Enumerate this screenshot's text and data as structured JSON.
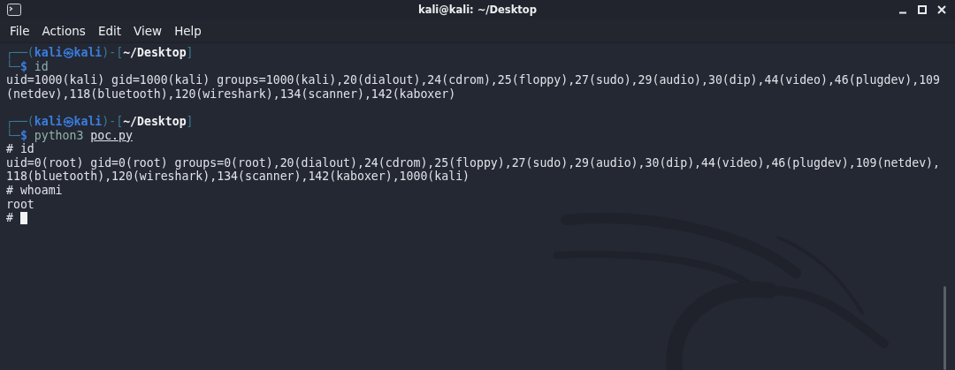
{
  "window": {
    "title": "kali@kali: ~/Desktop"
  },
  "menu": [
    "File",
    "Actions",
    "Edit",
    "View",
    "Help"
  ],
  "terminal": {
    "lines": [
      {
        "kind": "prompt",
        "open": "┌──(",
        "user": "kali㉿kali",
        "sep": ")-[",
        "cwd": "~/Desktop",
        "close": "]"
      },
      {
        "kind": "command",
        "corner": "└─",
        "dollar": "$",
        "command": "id"
      },
      {
        "kind": "output",
        "text": "uid=1000(kali) gid=1000(kali) groups=1000(kali),20(dialout),24(cdrom),25(floppy),27(sudo),29(audio),30(dip),44(video),46(plugdev),109"
      },
      {
        "kind": "output",
        "text": "(netdev),118(bluetooth),120(wireshark),134(scanner),142(kaboxer)"
      },
      {
        "kind": "blank"
      },
      {
        "kind": "prompt",
        "open": "┌──(",
        "user": "kali㉿kali",
        "sep": ")-[",
        "cwd": "~/Desktop",
        "close": "]"
      },
      {
        "kind": "command",
        "corner": "└─",
        "dollar": "$",
        "command": "python3",
        "argument": "poc.py"
      },
      {
        "kind": "output",
        "text": "# id"
      },
      {
        "kind": "output",
        "text": "uid=0(root) gid=0(root) groups=0(root),20(dialout),24(cdrom),25(floppy),27(sudo),29(audio),30(dip),44(video),46(plugdev),109(netdev),"
      },
      {
        "kind": "output",
        "text": "118(bluetooth),120(wireshark),134(scanner),142(kaboxer),1000(kali)"
      },
      {
        "kind": "output",
        "text": "# whoami"
      },
      {
        "kind": "output",
        "text": "root"
      },
      {
        "kind": "output",
        "text": "#",
        "cursor": true
      }
    ]
  }
}
